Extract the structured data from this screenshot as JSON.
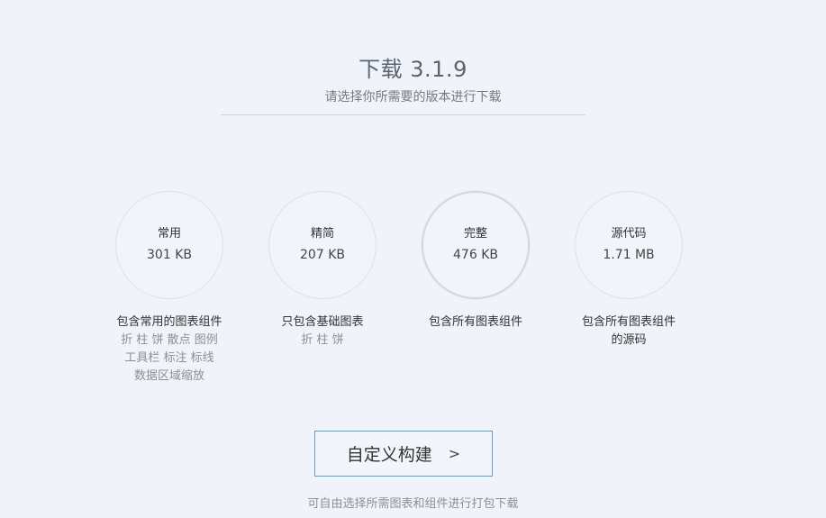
{
  "header": {
    "title": "下载 3.1.9",
    "subtitle": "请选择你所需要的版本进行下载"
  },
  "packages": [
    {
      "name": "常用",
      "size": "301 KB",
      "desc_main": "包含常用的图表组件",
      "desc_lines": [
        "折 柱 饼 散点 图例",
        "工具栏 标注 标线",
        "数据区域缩放"
      ]
    },
    {
      "name": "精简",
      "size": "207 KB",
      "desc_main": "只包含基础图表",
      "desc_lines": [
        "折 柱 饼"
      ]
    },
    {
      "name": "完整",
      "size": "476 KB",
      "desc_main": "包含所有图表组件",
      "desc_lines": []
    },
    {
      "name": "源代码",
      "size": "1.71 MB",
      "desc_main": "包含所有图表组件",
      "desc_main_2": "的源码",
      "desc_lines": []
    }
  ],
  "custom_build": {
    "label": "自定义构建",
    "arrow": ">"
  },
  "footer": {
    "note": "可自由选择所需图表和组件进行打包下载"
  }
}
